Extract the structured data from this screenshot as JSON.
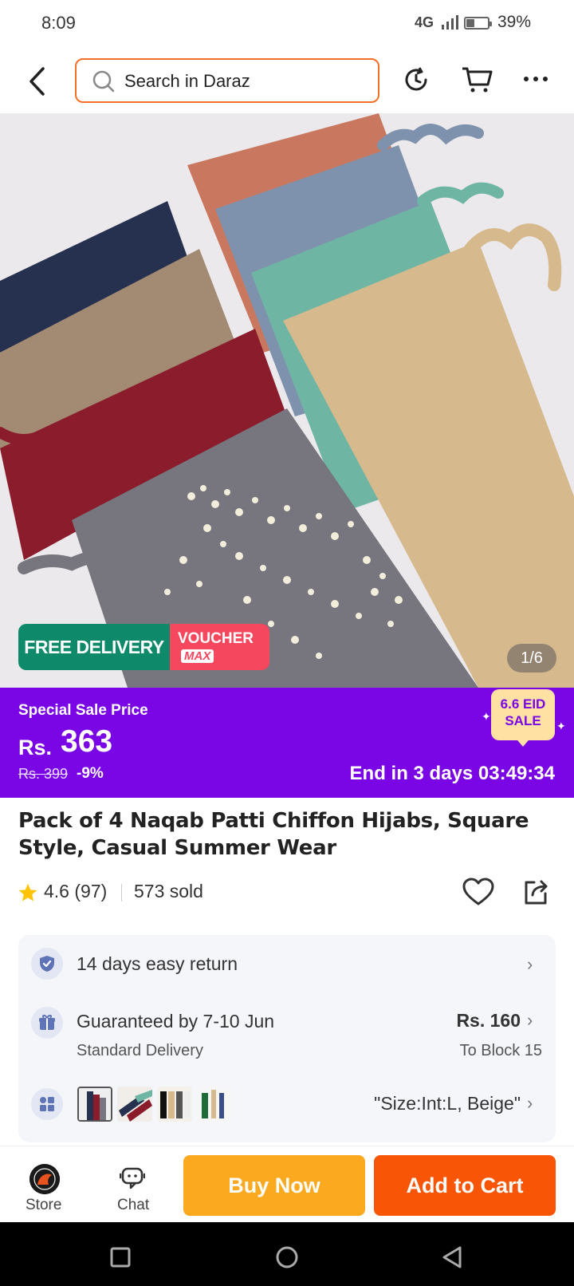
{
  "status_bar": {
    "time": "8:09",
    "network": "4G",
    "battery_pct": "39%",
    "battery_level": 0.39
  },
  "header": {
    "search_placeholder": "Search in Daraz"
  },
  "hero": {
    "badge_free_delivery": "FREE DELIVERY",
    "badge_voucher_top": "VOUCHER",
    "badge_voucher_bottom": "MAX",
    "image_counter": "1/6"
  },
  "sale": {
    "label": "Special Sale Price",
    "currency": "Rs.",
    "price": "363",
    "old_price": "Rs. 399",
    "discount": "-9%",
    "countdown": "End in 3 days 03:49:34",
    "event_line1": "6.6 EID",
    "event_line2": "SALE",
    "banner_color": "#7a06e6"
  },
  "product": {
    "title": "Pack of 4 Naqab Patti Chiffon Hijabs, Square Style, Casual Summer Wear",
    "rating": "4.6",
    "reviews": "(97)",
    "sold": "573 sold"
  },
  "info": {
    "returns": "14 days easy return",
    "delivery": "Guaranteed by 7-10 Jun",
    "delivery_type": "Standard Delivery",
    "delivery_fee": "Rs. 160",
    "delivery_to": "To Block 15",
    "variant": "\"Size:Int:L, Beige\""
  },
  "bottom": {
    "store_label": "Store",
    "chat_label": "Chat",
    "buy_now": "Buy Now",
    "add_to_cart": "Add to Cart",
    "buy_color": "#fbaa1f",
    "cart_color": "#f85606"
  },
  "icons": [
    "back-arrow-icon",
    "search-icon",
    "history-icon",
    "cart-icon",
    "more-icon",
    "star-icon",
    "heart-icon",
    "share-icon",
    "shield-icon",
    "gift-icon",
    "grid-icon",
    "chevron-right-icon",
    "store-icon",
    "chat-icon"
  ]
}
